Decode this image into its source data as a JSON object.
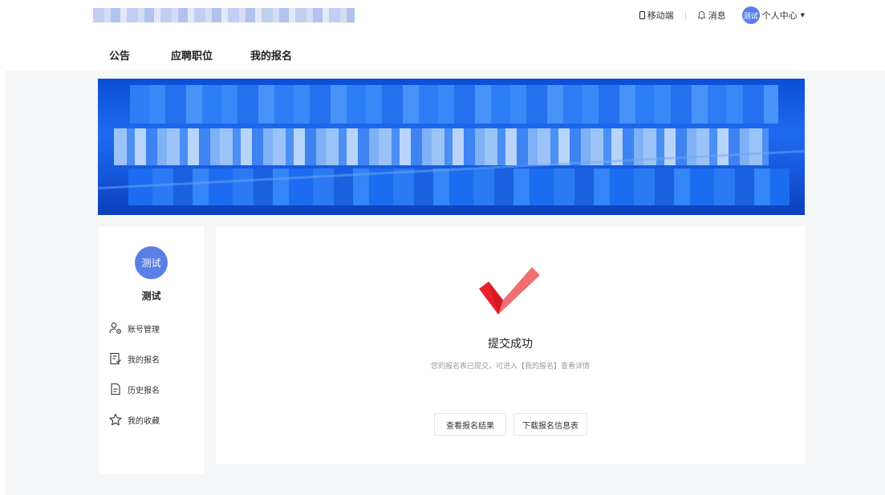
{
  "header": {
    "mobile_label": "移动端",
    "messages_label": "消息",
    "avatar_text": "测试",
    "personal_center_label": "个人中心"
  },
  "nav": {
    "items": [
      "公告",
      "应聘职位",
      "我的报名"
    ]
  },
  "sidebar": {
    "avatar_text": "测试",
    "user_name": "测试",
    "items": [
      {
        "label": "账号管理",
        "icon": "account-settings-icon"
      },
      {
        "label": "我的报名",
        "icon": "my-registration-icon"
      },
      {
        "label": "历史报名",
        "icon": "history-document-icon"
      },
      {
        "label": "我的收藏",
        "icon": "star-icon"
      }
    ]
  },
  "main": {
    "title": "提交成功",
    "description": "您的报名表已提交，可进入【我的报名】查看详情",
    "buttons": {
      "view_result": "查看报名结果",
      "download_form": "下载报名信息表"
    }
  },
  "colors": {
    "accent": "#5b7fe6",
    "check_red": "#e8212c",
    "check_pink": "#f06f72",
    "banner_blue": "#1f6af0",
    "background": "#f5f6f8"
  }
}
